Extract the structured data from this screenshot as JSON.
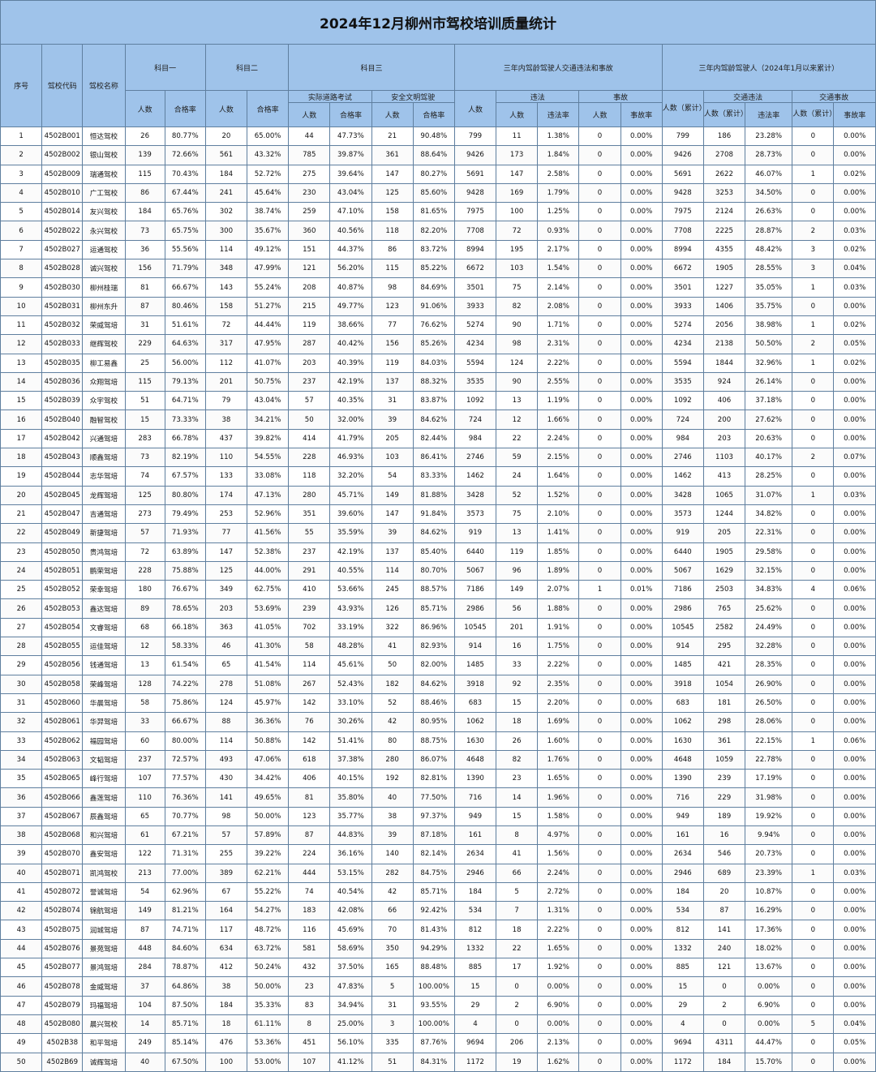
{
  "title": "2024年12月柳州市驾校培训质量统计",
  "headers": {
    "seq": "序号",
    "code": "驾校代码",
    "name": "驾校名称",
    "subject1": "科目一",
    "subject2": "科目二",
    "subject3": "科目三",
    "group_3yr": "三年内驾龄驾驶人交通违法和事故",
    "group_3yr_cum": "三年内驾龄驾驶人（2024年1月以来累计）",
    "road_exam": "实际道路考试",
    "safe_drive": "安全文明驾驶",
    "violation": "违法",
    "accident": "事故",
    "traffic_violation": "交通违法",
    "traffic_accident": "交通事故",
    "people": "人数",
    "pass_rate": "合格率",
    "violation_rate": "违法率",
    "accident_rate": "事故率",
    "people_cum": "人数（累计）"
  },
  "rows": [
    [
      "1",
      "4502B001",
      "恒达驾校",
      "26",
      "80.77%",
      "20",
      "65.00%",
      "44",
      "47.73%",
      "21",
      "90.48%",
      "799",
      "11",
      "1.38%",
      "0",
      "0.00%",
      "799",
      "186",
      "23.28%",
      "0",
      "0.00%"
    ],
    [
      "2",
      "4502B002",
      "银山驾校",
      "139",
      "72.66%",
      "561",
      "43.32%",
      "785",
      "39.87%",
      "361",
      "88.64%",
      "9426",
      "173",
      "1.84%",
      "0",
      "0.00%",
      "9426",
      "2708",
      "28.73%",
      "0",
      "0.00%"
    ],
    [
      "3",
      "4502B009",
      "瑞通驾校",
      "115",
      "70.43%",
      "184",
      "52.72%",
      "275",
      "39.64%",
      "147",
      "80.27%",
      "5691",
      "147",
      "2.58%",
      "0",
      "0.00%",
      "5691",
      "2622",
      "46.07%",
      "1",
      "0.02%"
    ],
    [
      "4",
      "4502B010",
      "广工驾校",
      "86",
      "67.44%",
      "241",
      "45.64%",
      "230",
      "43.04%",
      "125",
      "85.60%",
      "9428",
      "169",
      "1.79%",
      "0",
      "0.00%",
      "9428",
      "3253",
      "34.50%",
      "0",
      "0.00%"
    ],
    [
      "5",
      "4502B014",
      "友兴驾校",
      "184",
      "65.76%",
      "302",
      "38.74%",
      "259",
      "47.10%",
      "158",
      "81.65%",
      "7975",
      "100",
      "1.25%",
      "0",
      "0.00%",
      "7975",
      "2124",
      "26.63%",
      "0",
      "0.00%"
    ],
    [
      "6",
      "4502B022",
      "永兴驾校",
      "73",
      "65.75%",
      "300",
      "35.67%",
      "360",
      "40.56%",
      "118",
      "82.20%",
      "7708",
      "72",
      "0.93%",
      "0",
      "0.00%",
      "7708",
      "2225",
      "28.87%",
      "2",
      "0.03%"
    ],
    [
      "7",
      "4502B027",
      "运通驾校",
      "36",
      "55.56%",
      "114",
      "49.12%",
      "151",
      "44.37%",
      "86",
      "83.72%",
      "8994",
      "195",
      "2.17%",
      "0",
      "0.00%",
      "8994",
      "4355",
      "48.42%",
      "3",
      "0.02%"
    ],
    [
      "8",
      "4502B028",
      "诚兴驾校",
      "156",
      "71.79%",
      "348",
      "47.99%",
      "121",
      "56.20%",
      "115",
      "85.22%",
      "6672",
      "103",
      "1.54%",
      "0",
      "0.00%",
      "6672",
      "1905",
      "28.55%",
      "3",
      "0.04%"
    ],
    [
      "9",
      "4502B030",
      "柳州桂瑞",
      "81",
      "66.67%",
      "143",
      "55.24%",
      "208",
      "40.87%",
      "98",
      "84.69%",
      "3501",
      "75",
      "2.14%",
      "0",
      "0.00%",
      "3501",
      "1227",
      "35.05%",
      "1",
      "0.03%"
    ],
    [
      "10",
      "4502B031",
      "柳州东升",
      "87",
      "80.46%",
      "158",
      "51.27%",
      "215",
      "49.77%",
      "123",
      "91.06%",
      "3933",
      "82",
      "2.08%",
      "0",
      "0.00%",
      "3933",
      "1406",
      "35.75%",
      "0",
      "0.00%"
    ],
    [
      "11",
      "4502B032",
      "荣威驾培",
      "31",
      "51.61%",
      "72",
      "44.44%",
      "119",
      "38.66%",
      "77",
      "76.62%",
      "5274",
      "90",
      "1.71%",
      "0",
      "0.00%",
      "5274",
      "2056",
      "38.98%",
      "1",
      "0.02%"
    ],
    [
      "12",
      "4502B033",
      "继辉驾校",
      "229",
      "64.63%",
      "317",
      "47.95%",
      "287",
      "40.42%",
      "156",
      "85.26%",
      "4234",
      "98",
      "2.31%",
      "0",
      "0.00%",
      "4234",
      "2138",
      "50.50%",
      "2",
      "0.05%"
    ],
    [
      "13",
      "4502B035",
      "柳工易鑫",
      "25",
      "56.00%",
      "112",
      "41.07%",
      "203",
      "40.39%",
      "119",
      "84.03%",
      "5594",
      "124",
      "2.22%",
      "0",
      "0.00%",
      "5594",
      "1844",
      "32.96%",
      "1",
      "0.02%"
    ],
    [
      "14",
      "4502B036",
      "众翔驾培",
      "115",
      "79.13%",
      "201",
      "50.75%",
      "237",
      "42.19%",
      "137",
      "88.32%",
      "3535",
      "90",
      "2.55%",
      "0",
      "0.00%",
      "3535",
      "924",
      "26.14%",
      "0",
      "0.00%"
    ],
    [
      "15",
      "4502B039",
      "众宇驾校",
      "51",
      "64.71%",
      "79",
      "43.04%",
      "57",
      "40.35%",
      "31",
      "83.87%",
      "1092",
      "13",
      "1.19%",
      "0",
      "0.00%",
      "1092",
      "406",
      "37.18%",
      "0",
      "0.00%"
    ],
    [
      "16",
      "4502B040",
      "融智驾校",
      "15",
      "73.33%",
      "38",
      "34.21%",
      "50",
      "32.00%",
      "39",
      "84.62%",
      "724",
      "12",
      "1.66%",
      "0",
      "0.00%",
      "724",
      "200",
      "27.62%",
      "0",
      "0.00%"
    ],
    [
      "17",
      "4502B042",
      "兴通驾培",
      "283",
      "66.78%",
      "437",
      "39.82%",
      "414",
      "41.79%",
      "205",
      "82.44%",
      "984",
      "22",
      "2.24%",
      "0",
      "0.00%",
      "984",
      "203",
      "20.63%",
      "0",
      "0.00%"
    ],
    [
      "18",
      "4502B043",
      "顺鑫驾培",
      "73",
      "82.19%",
      "110",
      "54.55%",
      "228",
      "46.93%",
      "103",
      "86.41%",
      "2746",
      "59",
      "2.15%",
      "0",
      "0.00%",
      "2746",
      "1103",
      "40.17%",
      "2",
      "0.07%"
    ],
    [
      "19",
      "4502B044",
      "志华驾培",
      "74",
      "67.57%",
      "133",
      "33.08%",
      "118",
      "32.20%",
      "54",
      "83.33%",
      "1462",
      "24",
      "1.64%",
      "0",
      "0.00%",
      "1462",
      "413",
      "28.25%",
      "0",
      "0.00%"
    ],
    [
      "20",
      "4502B045",
      "龙辉驾培",
      "125",
      "80.80%",
      "174",
      "47.13%",
      "280",
      "45.71%",
      "149",
      "81.88%",
      "3428",
      "52",
      "1.52%",
      "0",
      "0.00%",
      "3428",
      "1065",
      "31.07%",
      "1",
      "0.03%"
    ],
    [
      "21",
      "4502B047",
      "吉通驾培",
      "273",
      "79.49%",
      "253",
      "52.96%",
      "351",
      "39.60%",
      "147",
      "91.84%",
      "3573",
      "75",
      "2.10%",
      "0",
      "0.00%",
      "3573",
      "1244",
      "34.82%",
      "0",
      "0.00%"
    ],
    [
      "22",
      "4502B049",
      "新捷驾培",
      "57",
      "71.93%",
      "77",
      "41.56%",
      "55",
      "35.59%",
      "39",
      "84.62%",
      "919",
      "13",
      "1.41%",
      "0",
      "0.00%",
      "919",
      "205",
      "22.31%",
      "0",
      "0.00%"
    ],
    [
      "23",
      "4502B050",
      "贵鸿驾培",
      "72",
      "63.89%",
      "147",
      "52.38%",
      "237",
      "42.19%",
      "137",
      "85.40%",
      "6440",
      "119",
      "1.85%",
      "0",
      "0.00%",
      "6440",
      "1905",
      "29.58%",
      "0",
      "0.00%"
    ],
    [
      "24",
      "4502B051",
      "鹏荣驾培",
      "228",
      "75.88%",
      "125",
      "44.00%",
      "291",
      "40.55%",
      "114",
      "80.70%",
      "5067",
      "96",
      "1.89%",
      "0",
      "0.00%",
      "5067",
      "1629",
      "32.15%",
      "0",
      "0.00%"
    ],
    [
      "25",
      "4502B052",
      "荣幸驾培",
      "180",
      "76.67%",
      "349",
      "62.75%",
      "410",
      "53.66%",
      "245",
      "88.57%",
      "7186",
      "149",
      "2.07%",
      "1",
      "0.01%",
      "7186",
      "2503",
      "34.83%",
      "4",
      "0.06%"
    ],
    [
      "26",
      "4502B053",
      "鑫达驾培",
      "89",
      "78.65%",
      "203",
      "53.69%",
      "239",
      "43.93%",
      "126",
      "85.71%",
      "2986",
      "56",
      "1.88%",
      "0",
      "0.00%",
      "2986",
      "765",
      "25.62%",
      "0",
      "0.00%"
    ],
    [
      "27",
      "4502B054",
      "文睿驾培",
      "68",
      "66.18%",
      "363",
      "41.05%",
      "702",
      "33.19%",
      "322",
      "86.96%",
      "10545",
      "201",
      "1.91%",
      "0",
      "0.00%",
      "10545",
      "2582",
      "24.49%",
      "0",
      "0.00%"
    ],
    [
      "28",
      "4502B055",
      "运佳驾培",
      "12",
      "58.33%",
      "46",
      "41.30%",
      "58",
      "48.28%",
      "41",
      "82.93%",
      "914",
      "16",
      "1.75%",
      "0",
      "0.00%",
      "914",
      "295",
      "32.28%",
      "0",
      "0.00%"
    ],
    [
      "29",
      "4502B056",
      "钱通驾培",
      "13",
      "61.54%",
      "65",
      "41.54%",
      "114",
      "45.61%",
      "50",
      "82.00%",
      "1485",
      "33",
      "2.22%",
      "0",
      "0.00%",
      "1485",
      "421",
      "28.35%",
      "0",
      "0.00%"
    ],
    [
      "30",
      "4502B058",
      "荣峰驾培",
      "128",
      "74.22%",
      "278",
      "51.08%",
      "267",
      "52.43%",
      "182",
      "84.62%",
      "3918",
      "92",
      "2.35%",
      "0",
      "0.00%",
      "3918",
      "1054",
      "26.90%",
      "0",
      "0.00%"
    ],
    [
      "31",
      "4502B060",
      "华晨驾培",
      "58",
      "75.86%",
      "124",
      "45.97%",
      "142",
      "33.10%",
      "52",
      "88.46%",
      "683",
      "15",
      "2.20%",
      "0",
      "0.00%",
      "683",
      "181",
      "26.50%",
      "0",
      "0.00%"
    ],
    [
      "32",
      "4502B061",
      "华羿驾培",
      "33",
      "66.67%",
      "88",
      "36.36%",
      "76",
      "30.26%",
      "42",
      "80.95%",
      "1062",
      "18",
      "1.69%",
      "0",
      "0.00%",
      "1062",
      "298",
      "28.06%",
      "0",
      "0.00%"
    ],
    [
      "33",
      "4502B062",
      "福园驾培",
      "60",
      "80.00%",
      "114",
      "50.88%",
      "142",
      "51.41%",
      "80",
      "88.75%",
      "1630",
      "26",
      "1.60%",
      "0",
      "0.00%",
      "1630",
      "361",
      "22.15%",
      "1",
      "0.06%"
    ],
    [
      "34",
      "4502B063",
      "文韬驾培",
      "237",
      "72.57%",
      "493",
      "47.06%",
      "618",
      "37.38%",
      "280",
      "86.07%",
      "4648",
      "82",
      "1.76%",
      "0",
      "0.00%",
      "4648",
      "1059",
      "22.78%",
      "0",
      "0.00%"
    ],
    [
      "35",
      "4502B065",
      "峰行驾培",
      "107",
      "77.57%",
      "430",
      "34.42%",
      "406",
      "40.15%",
      "192",
      "82.81%",
      "1390",
      "23",
      "1.65%",
      "0",
      "0.00%",
      "1390",
      "239",
      "17.19%",
      "0",
      "0.00%"
    ],
    [
      "36",
      "4502B066",
      "鑫莲驾培",
      "110",
      "76.36%",
      "141",
      "49.65%",
      "81",
      "35.80%",
      "40",
      "77.50%",
      "716",
      "14",
      "1.96%",
      "0",
      "0.00%",
      "716",
      "229",
      "31.98%",
      "0",
      "0.00%"
    ],
    [
      "37",
      "4502B067",
      "辰鑫驾培",
      "65",
      "70.77%",
      "98",
      "50.00%",
      "123",
      "35.77%",
      "38",
      "97.37%",
      "949",
      "15",
      "1.58%",
      "0",
      "0.00%",
      "949",
      "189",
      "19.92%",
      "0",
      "0.00%"
    ],
    [
      "38",
      "4502B068",
      "和兴驾培",
      "61",
      "67.21%",
      "57",
      "57.89%",
      "87",
      "44.83%",
      "39",
      "87.18%",
      "161",
      "8",
      "4.97%",
      "0",
      "0.00%",
      "161",
      "16",
      "9.94%",
      "0",
      "0.00%"
    ],
    [
      "39",
      "4502B070",
      "鑫安驾培",
      "122",
      "71.31%",
      "255",
      "39.22%",
      "224",
      "36.16%",
      "140",
      "82.14%",
      "2634",
      "41",
      "1.56%",
      "0",
      "0.00%",
      "2634",
      "546",
      "20.73%",
      "0",
      "0.00%"
    ],
    [
      "40",
      "4502B071",
      "凯鸿驾校",
      "213",
      "77.00%",
      "389",
      "62.21%",
      "444",
      "53.15%",
      "282",
      "84.75%",
      "2946",
      "66",
      "2.24%",
      "0",
      "0.00%",
      "2946",
      "689",
      "23.39%",
      "1",
      "0.03%"
    ],
    [
      "41",
      "4502B072",
      "誉诚驾培",
      "54",
      "62.96%",
      "67",
      "55.22%",
      "74",
      "40.54%",
      "42",
      "85.71%",
      "184",
      "5",
      "2.72%",
      "0",
      "0.00%",
      "184",
      "20",
      "10.87%",
      "0",
      "0.00%"
    ],
    [
      "42",
      "4502B074",
      "锦航驾培",
      "149",
      "81.21%",
      "164",
      "54.27%",
      "183",
      "42.08%",
      "66",
      "92.42%",
      "534",
      "7",
      "1.31%",
      "0",
      "0.00%",
      "534",
      "87",
      "16.29%",
      "0",
      "0.00%"
    ],
    [
      "43",
      "4502B075",
      "润城驾培",
      "87",
      "74.71%",
      "117",
      "48.72%",
      "116",
      "45.69%",
      "70",
      "81.43%",
      "812",
      "18",
      "2.22%",
      "0",
      "0.00%",
      "812",
      "141",
      "17.36%",
      "0",
      "0.00%"
    ],
    [
      "44",
      "4502B076",
      "景苑驾培",
      "448",
      "84.60%",
      "634",
      "63.72%",
      "581",
      "58.69%",
      "350",
      "94.29%",
      "1332",
      "22",
      "1.65%",
      "0",
      "0.00%",
      "1332",
      "240",
      "18.02%",
      "0",
      "0.00%"
    ],
    [
      "45",
      "4502B077",
      "景鸿驾培",
      "284",
      "78.87%",
      "412",
      "50.24%",
      "432",
      "37.50%",
      "165",
      "88.48%",
      "885",
      "17",
      "1.92%",
      "0",
      "0.00%",
      "885",
      "121",
      "13.67%",
      "0",
      "0.00%"
    ],
    [
      "46",
      "4502B078",
      "金威驾培",
      "37",
      "64.86%",
      "38",
      "50.00%",
      "23",
      "47.83%",
      "5",
      "100.00%",
      "15",
      "0",
      "0.00%",
      "0",
      "0.00%",
      "15",
      "0",
      "0.00%",
      "0",
      "0.00%"
    ],
    [
      "47",
      "4502B079",
      "玛福驾培",
      "104",
      "87.50%",
      "184",
      "35.33%",
      "83",
      "34.94%",
      "31",
      "93.55%",
      "29",
      "2",
      "6.90%",
      "0",
      "0.00%",
      "29",
      "2",
      "6.90%",
      "0",
      "0.00%"
    ],
    [
      "48",
      "4502B080",
      "晨兴驾校",
      "14",
      "85.71%",
      "18",
      "61.11%",
      "8",
      "25.00%",
      "3",
      "100.00%",
      "4",
      "0",
      "0.00%",
      "0",
      "0.00%",
      "4",
      "0",
      "0.00%",
      "5",
      "0.04%"
    ],
    [
      "49",
      "4502B38",
      "和平驾培",
      "249",
      "85.14%",
      "476",
      "53.36%",
      "451",
      "56.10%",
      "335",
      "87.76%",
      "9694",
      "206",
      "2.13%",
      "0",
      "0.00%",
      "9694",
      "4311",
      "44.47%",
      "0",
      "0.05%"
    ],
    [
      "50",
      "4502B69",
      "诚辉驾培",
      "40",
      "67.50%",
      "100",
      "53.00%",
      "107",
      "41.12%",
      "51",
      "84.31%",
      "1172",
      "19",
      "1.62%",
      "0",
      "0.00%",
      "1172",
      "184",
      "15.70%",
      "0",
      "0.00%"
    ]
  ]
}
